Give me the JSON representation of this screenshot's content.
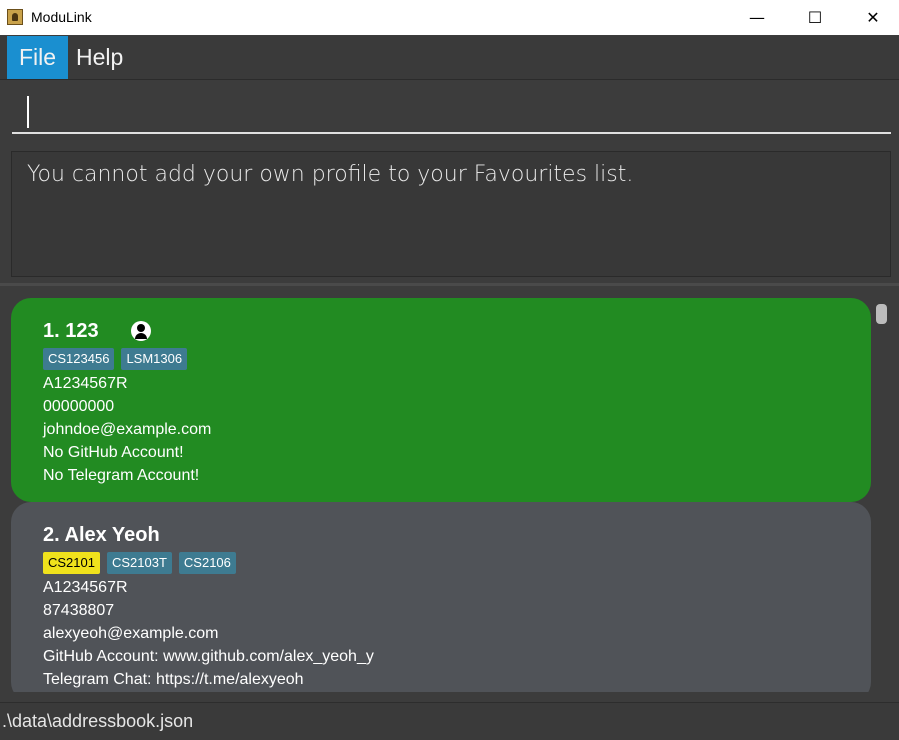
{
  "window": {
    "title": "ModuLink",
    "minimize_label": "—",
    "maximize_label": "☐",
    "close_label": "✕"
  },
  "menu": {
    "file": "File",
    "help": "Help"
  },
  "command_box": {
    "value": ""
  },
  "result_display": {
    "message": "You cannot add your own profile to your Favourites list."
  },
  "persons": [
    {
      "name": "1. 123",
      "is_own_profile": true,
      "tags": [
        {
          "label": "CS123456",
          "color": "#3e7b91"
        },
        {
          "label": "LSM1306",
          "color": "#3e7b91"
        }
      ],
      "student_id": "A1234567R",
      "phone": "00000000",
      "email": "johndoe@example.com",
      "github": "No GitHub Account!",
      "telegram": "No Telegram Account!",
      "card_color": "#228b22"
    },
    {
      "name": "2. Alex Yeoh",
      "is_own_profile": false,
      "tags": [
        {
          "label": "CS2101",
          "color": "#f0e21c"
        },
        {
          "label": "CS2103T",
          "color": "#3e7b91"
        },
        {
          "label": "CS2106",
          "color": "#3e7b91"
        }
      ],
      "student_id": "A1234567R",
      "phone": "87438807",
      "email": "alexyeoh@example.com",
      "github": "GitHub Account: www.github.com/alex_yeoh_y",
      "telegram": "Telegram Chat: https://t.me/alexyeoh",
      "card_color": "#505358"
    }
  ],
  "status_bar": {
    "save_location": ".\\data\\addressbook.json"
  }
}
